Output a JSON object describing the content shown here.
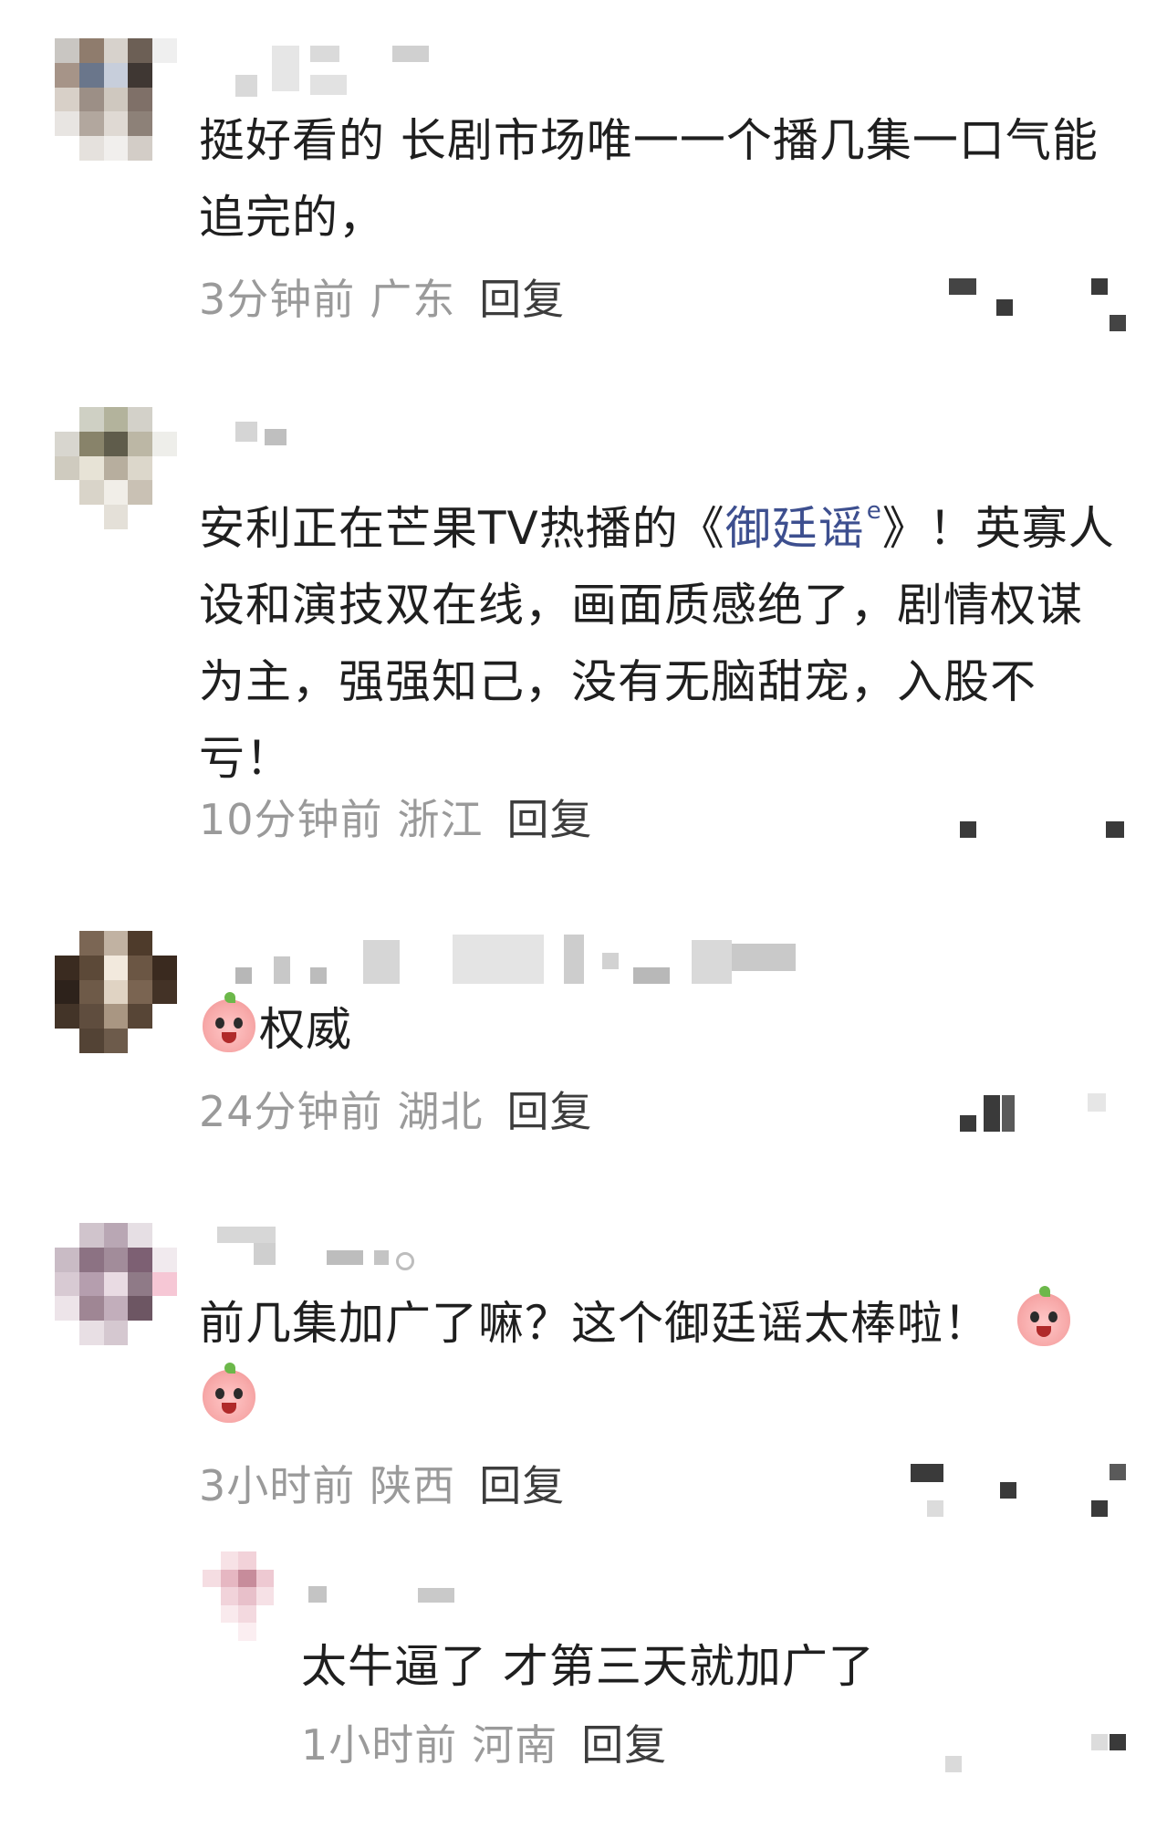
{
  "comments": [
    {
      "text": "挺好看的  长剧市场唯一一个播几集一口气能追完的，",
      "time": "3分钟前",
      "location": "广东",
      "reply_label": "回复"
    },
    {
      "text_before": "安利正在芒果TV热播的《",
      "link": "御廷谣",
      "text_after": "》！英寡人设和演技双在线，画面质感绝了，剧情权谋为主，强强知己，没有无脑甜宠，入股不亏！",
      "time": "10分钟前",
      "location": "浙江",
      "reply_label": "回复"
    },
    {
      "text": "权威",
      "time": "24分钟前",
      "location": "湖北",
      "reply_label": "回复"
    },
    {
      "text": "前几集加广了嘛？这个御廷谣太棒啦！",
      "time": "3小时前",
      "location": "陕西",
      "reply_label": "回复"
    }
  ],
  "reply": {
    "text": "太牛逼了 才第三天就加广了",
    "time": "1小时前",
    "location": "河南",
    "reply_label": "回复"
  },
  "icons": {
    "emoji": "pink-bean-emoji",
    "link": "search-link-icon"
  },
  "colors": {
    "text": "#1f1f1f",
    "meta": "#9a9a9a",
    "link": "#3d4f8f",
    "reply": "#3d3d3d"
  }
}
